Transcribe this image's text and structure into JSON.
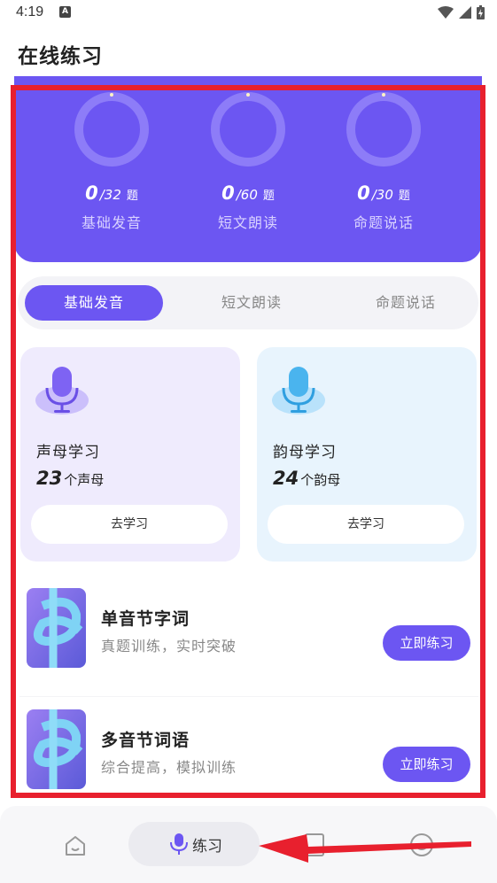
{
  "status_bar": {
    "time": "4:19",
    "notification_icon": "A"
  },
  "header": {
    "title": "在线练习"
  },
  "stats": [
    {
      "done": "0",
      "total": "/32",
      "unit": "题",
      "label": "基础发音"
    },
    {
      "done": "0",
      "total": "/60",
      "unit": "题",
      "label": "短文朗读"
    },
    {
      "done": "0",
      "total": "/30",
      "unit": "题",
      "label": "命题说话"
    }
  ],
  "tabs": [
    {
      "label": "基础发音",
      "active": true
    },
    {
      "label": "短文朗读",
      "active": false
    },
    {
      "label": "命题说话",
      "active": false
    }
  ],
  "cards": [
    {
      "title": "声母学习",
      "count": "23",
      "unit": "个声母",
      "button": "去学习",
      "icon": "microphone-icon"
    },
    {
      "title": "韵母学习",
      "count": "24",
      "unit": "个韵母",
      "button": "去学习",
      "icon": "microphone-icon"
    }
  ],
  "list": [
    {
      "title": "单音节字词",
      "subtitle": "真题训练，实时突破",
      "button": "立即练习"
    },
    {
      "title": "多音节词语",
      "subtitle": "综合提高，模拟训练",
      "button": "立即练习"
    }
  ],
  "bottom_nav": {
    "items": [
      {
        "icon": "home-icon"
      },
      {
        "icon": "microphone-icon",
        "label": "练习",
        "active": true
      },
      {
        "icon": "book-icon"
      },
      {
        "icon": "profile-icon"
      }
    ]
  },
  "colors": {
    "accent": "#6c56f2",
    "highlight": "#e8202e"
  }
}
